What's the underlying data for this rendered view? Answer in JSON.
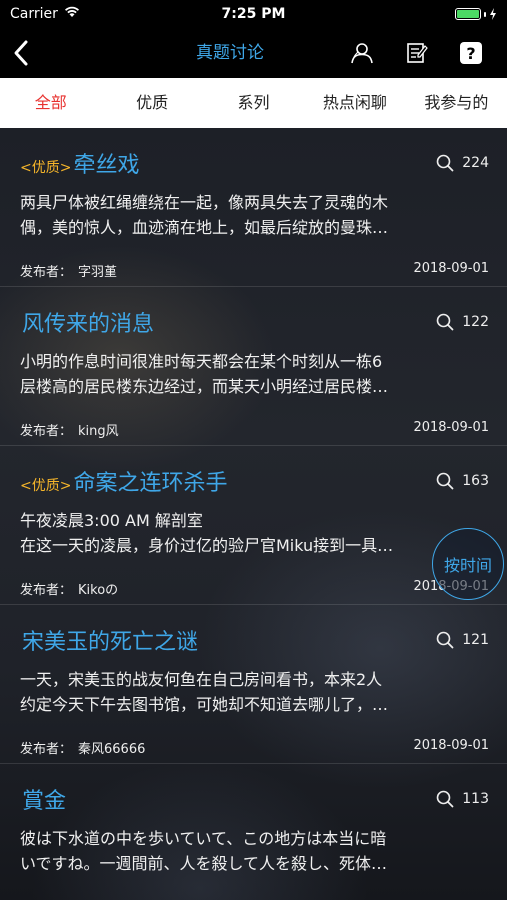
{
  "status_bar": {
    "carrier": "Carrier",
    "time": "7:25 PM"
  },
  "nav": {
    "title": "真题讨论",
    "back_icon": "chevron-left-icon",
    "icons": [
      "user-icon",
      "note-icon",
      "help-icon"
    ],
    "help_label": "?"
  },
  "tabs": [
    {
      "label": "全部",
      "active": true
    },
    {
      "label": "优质",
      "active": false
    },
    {
      "label": "系列",
      "active": false
    },
    {
      "label": "热点闲聊",
      "active": false
    },
    {
      "label": "我参与的",
      "active": false
    }
  ],
  "posts": [
    {
      "quality_tag": "<优质>",
      "title": "牵丝戏",
      "views": "224",
      "line1": "两具尸体被红绳缠绕在一起，像两具失去了灵魂的木",
      "line2": "偶，美的惊人，血迹滴在地上，如最后绽放的曼珠…",
      "author_label": "发布者：",
      "author": "字羽堇",
      "date": "2018-09-01"
    },
    {
      "quality_tag": "",
      "title": "风传来的消息",
      "views": "122",
      "line1": "小明的作息时间很准时每天都会在某个时刻从一栋6",
      "line2": "层楼高的居民楼东边经过，而某天小明经过居民楼…",
      "author_label": "发布者：",
      "author": "king风",
      "date": "2018-09-01"
    },
    {
      "quality_tag": "<优质>",
      "title": "命案之连环杀手",
      "views": "163",
      "line1": "午夜凌晨3:00 AM 解剖室",
      "line2": "在这一天的凌晨，身价过亿的验尸官Miku接到一具…",
      "author_label": "发布者：",
      "author": "Kikoの",
      "date": "2018-09-01"
    },
    {
      "quality_tag": "",
      "title": "宋美玉的死亡之谜",
      "views": "121",
      "line1": "一天，宋美玉的战友何鱼在自己房间看书，本来2人",
      "line2": "约定今天下午去图书馆，可她却不知道去哪儿了，…",
      "author_label": "发布者：",
      "author": "秦风66666",
      "date": "2018-09-01"
    },
    {
      "quality_tag": "",
      "title": "賞金",
      "views": "113",
      "line1": "彼は下水道の中を歩いていて、この地方は本当に暗",
      "line2": "いですね。一週間前、人を殺して人を殺し、死体…",
      "author_label": "",
      "author": "",
      "date": ""
    }
  ],
  "sort_button": "按时间",
  "colors": {
    "accent": "#3fa7e8",
    "quality": "#f5b52a",
    "active_tab": "#e8322f"
  }
}
